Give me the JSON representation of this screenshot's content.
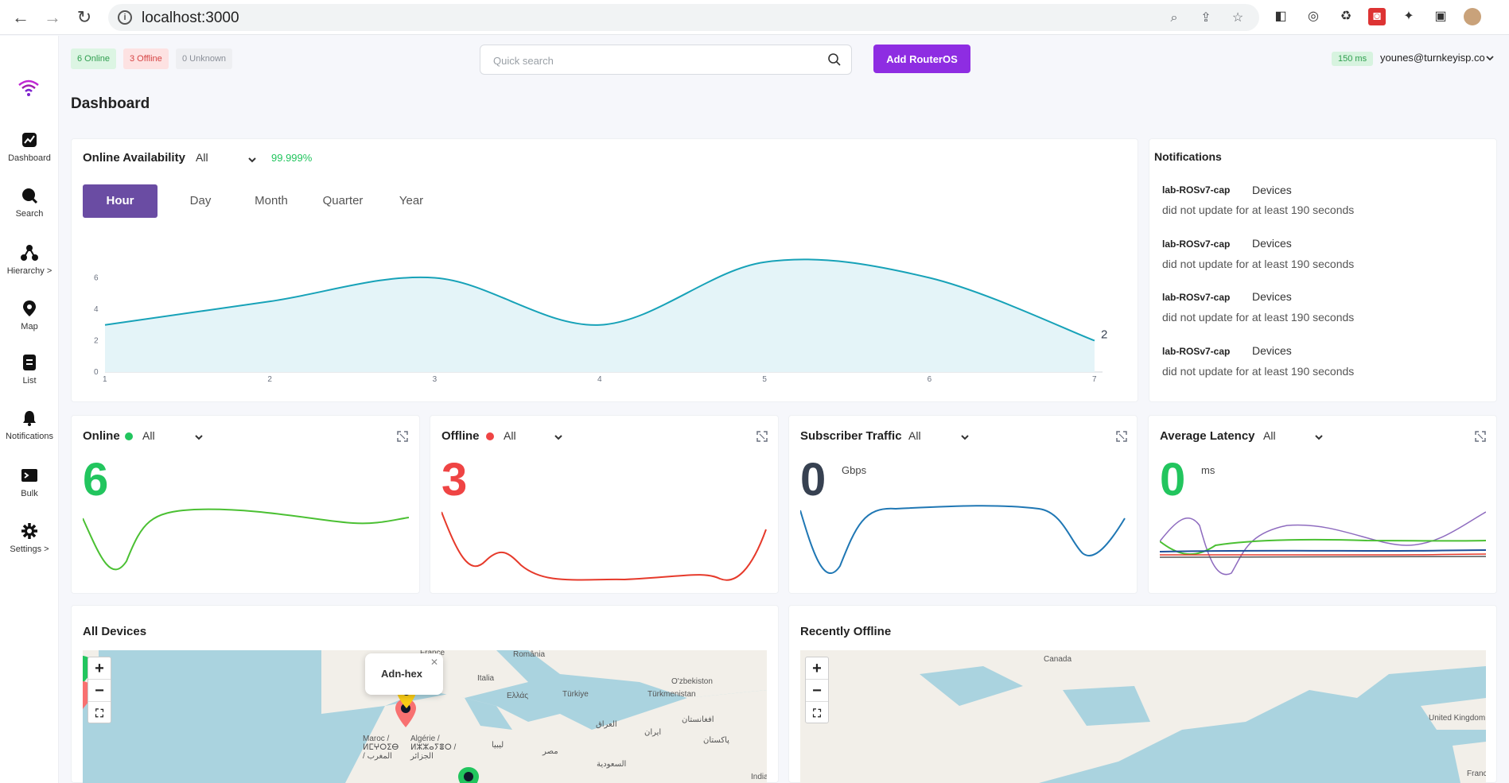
{
  "browser": {
    "url": "localhost:3000"
  },
  "topbar": {
    "badges": {
      "online": "6 Online",
      "offline": "3 Offline",
      "unknown": "0 Unknown"
    },
    "search_placeholder": "Quick search",
    "add_button": "Add RouterOS",
    "latency": "150 ms",
    "user_email": "younes@turnkeyisp.co"
  },
  "sidebar": {
    "items": [
      {
        "label": "Dashboard",
        "icon": "chart-icon"
      },
      {
        "label": "Search",
        "icon": "search-icon"
      },
      {
        "label": "Hierarchy >",
        "icon": "hierarchy-icon"
      },
      {
        "label": "Map",
        "icon": "map-pin-icon"
      },
      {
        "label": "List",
        "icon": "list-icon"
      },
      {
        "label": "Notifications",
        "icon": "bell-icon"
      },
      {
        "label": "Bulk",
        "icon": "terminal-icon"
      },
      {
        "label": "Settings >",
        "icon": "gear-icon"
      }
    ]
  },
  "page": {
    "title": "Dashboard"
  },
  "availability": {
    "title": "Online Availability",
    "filter": "All",
    "percent": "99.999%",
    "tabs": [
      "Hour",
      "Day",
      "Month",
      "Quarter",
      "Year"
    ],
    "active_tab": "Hour",
    "end_label": "2"
  },
  "notifications": {
    "title": "Notifications",
    "items": [
      {
        "device": "lab-ROSv7-cap",
        "type": "Devices",
        "message": "did not update for at least 190 seconds"
      },
      {
        "device": "lab-ROSv7-cap",
        "type": "Devices",
        "message": "did not update for at least 190 seconds"
      },
      {
        "device": "lab-ROSv7-cap",
        "type": "Devices",
        "message": "did not update for at least 190 seconds"
      },
      {
        "device": "lab-ROSv7-cap",
        "type": "Devices",
        "message": "did not update for at least 190 seconds"
      }
    ]
  },
  "stats": {
    "online": {
      "title": "Online",
      "filter": "All",
      "value": "6",
      "color": "#22c55e"
    },
    "offline": {
      "title": "Offline",
      "filter": "All",
      "value": "3",
      "color": "#ef4444"
    },
    "traffic": {
      "title": "Subscriber Traffic",
      "filter": "All",
      "value": "0",
      "unit": "Gbps"
    },
    "latency": {
      "title": "Average Latency",
      "filter": "All",
      "value": "0",
      "unit": "ms"
    }
  },
  "maps": {
    "all_devices": {
      "title": "All Devices",
      "popup": "Adn-hex",
      "labels": [
        "France",
        "România",
        "Italia",
        "Ελλάς",
        "Türkiye",
        "Türkmenistan",
        "O'zbekiston",
        "افغانستان",
        "ایران",
        "العراق",
        "پاکستان",
        "مصر",
        "السعودية",
        "Maroc / ⵍⵎⵖⵔⵉⴱ / المغرب",
        "Algérie / ⵍⵣⵣⴰⵢⴻⵔ / الجزائر",
        "ليبيا",
        "India"
      ]
    },
    "recently_offline": {
      "title": "Recently Offline",
      "labels": [
        "Canada",
        "United Kingdom",
        "France"
      ]
    }
  },
  "chart_data": {
    "type": "area",
    "x": [
      1,
      2,
      3,
      4,
      5,
      6,
      7
    ],
    "y": [
      3,
      4.5,
      6,
      3,
      7,
      6,
      2
    ],
    "xlim": [
      1,
      7
    ],
    "ylim": [
      0,
      8
    ],
    "yticks": [
      0,
      2,
      4,
      6
    ],
    "xticks": [
      1,
      2,
      3,
      4,
      5,
      6,
      7
    ],
    "colors": {
      "line": "#17a2b8",
      "fill": "#e4f4f8"
    }
  }
}
